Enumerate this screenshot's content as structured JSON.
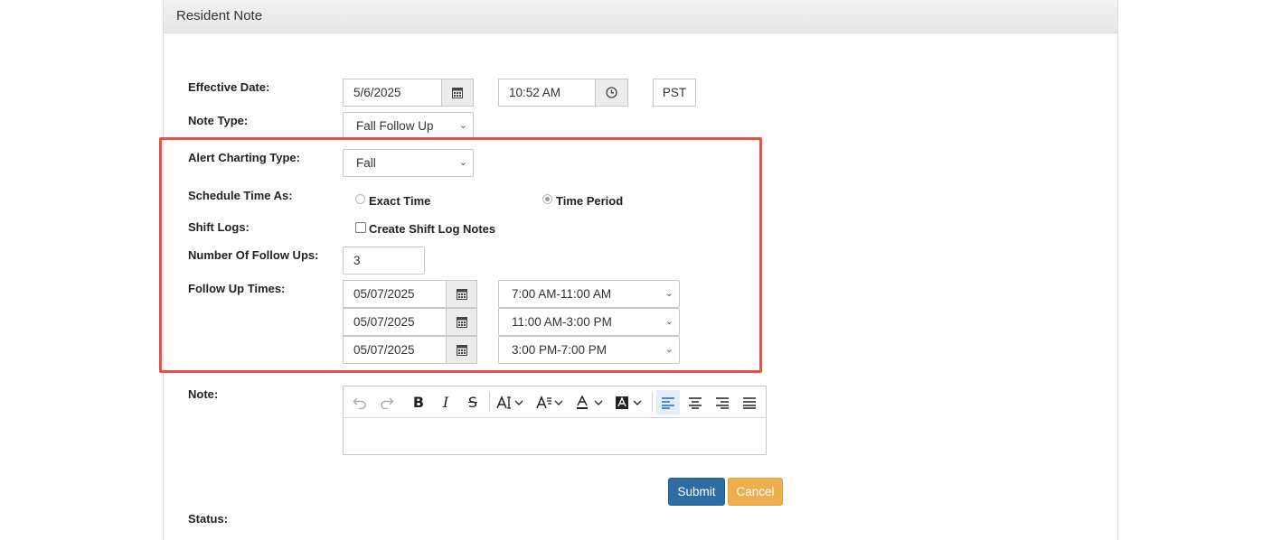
{
  "panel": {
    "title": "Resident Note"
  },
  "form": {
    "effective_date": {
      "label": "Effective Date:",
      "date": "5/6/2025",
      "time": "10:52 AM",
      "timezone": "PST"
    },
    "note_type": {
      "label": "Note Type:",
      "value": "Fall Follow Up"
    },
    "alert_charting_type": {
      "label": "Alert Charting Type:",
      "value": "Fall"
    },
    "schedule_time_as": {
      "label": "Schedule Time As:",
      "options": [
        {
          "label": "Exact Time",
          "checked": false
        },
        {
          "label": "Time Period",
          "checked": true
        }
      ]
    },
    "shift_logs": {
      "label": "Shift Logs:",
      "checkbox_label": "Create Shift Log Notes",
      "checked": false
    },
    "number_of_follow_ups": {
      "label": "Number Of Follow Ups:",
      "value": "3"
    },
    "follow_up_times": {
      "label": "Follow Up Times:",
      "rows": [
        {
          "date": "05/07/2025",
          "period": "7:00 AM-11:00 AM"
        },
        {
          "date": "05/07/2025",
          "period": "11:00 AM-3:00 PM"
        },
        {
          "date": "05/07/2025",
          "period": "3:00 PM-7:00 PM"
        }
      ]
    },
    "note": {
      "label": "Note:",
      "content": ""
    },
    "status": {
      "label": "Status:"
    }
  },
  "toolbar": {
    "items": [
      "undo-icon",
      "redo-icon",
      "bold-icon",
      "italic-icon",
      "strikethrough-icon",
      "font-size-icon",
      "font-family-icon",
      "font-color-icon",
      "background-color-icon",
      "align-left-icon",
      "align-center-icon",
      "align-right-icon",
      "align-justify-icon"
    ],
    "active": "align-left-icon"
  },
  "buttons": {
    "submit": "Submit",
    "cancel": "Cancel"
  },
  "colors": {
    "highlight_border": "#e0544a",
    "submit_bg": "#2e6da4",
    "cancel_bg": "#f0ad4e",
    "active_tool": "#1a66c9"
  }
}
